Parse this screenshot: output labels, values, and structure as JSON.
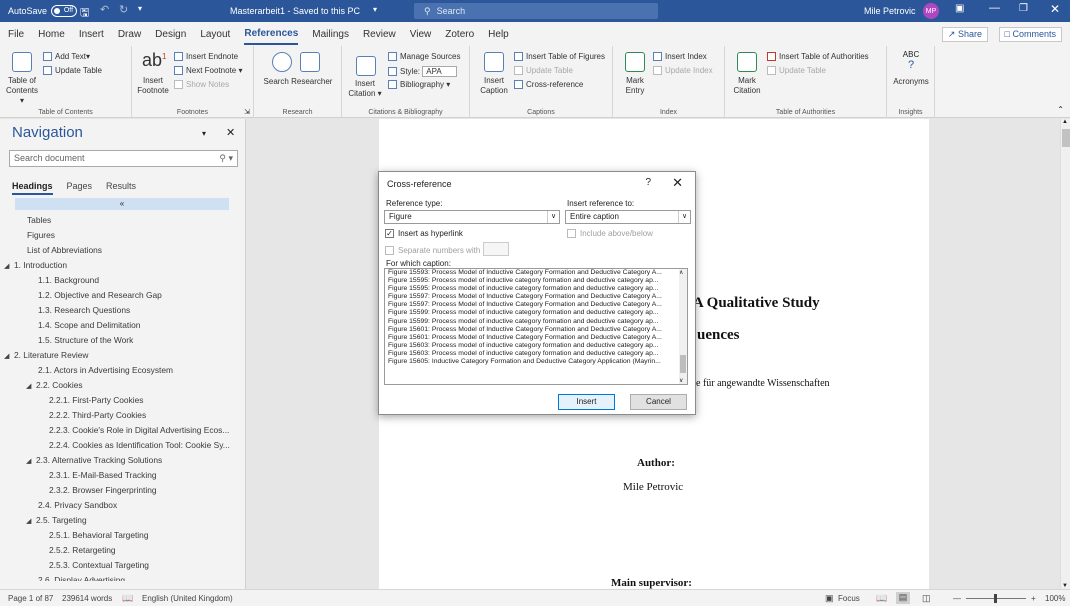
{
  "titlebar": {
    "autosave_label": "AutoSave",
    "autosave_state": "Off",
    "doc_title": "Masterarbeit1 - Saved to this PC",
    "search_placeholder": "Search",
    "user_name": "Mile Petrovic",
    "user_initials": "MP",
    "colors": {
      "bar": "#2b579a"
    }
  },
  "menus": [
    "File",
    "Home",
    "Insert",
    "Draw",
    "Design",
    "Layout",
    "References",
    "Mailings",
    "Review",
    "View",
    "Zotero",
    "Help"
  ],
  "active_menu": "References",
  "share_label": "Share",
  "comments_label": "Comments",
  "ribbon": {
    "toc": {
      "line1": "Table of",
      "line2": "Contents",
      "add_text": "Add Text",
      "update_table": "Update Table",
      "group": "Table of Contents"
    },
    "footnotes": {
      "insert1": "Insert",
      "insert2": "Footnote",
      "insert_endnote": "Insert Endnote",
      "next_footnote": "Next Footnote",
      "show_notes": "Show Notes",
      "group": "Footnotes"
    },
    "research": {
      "search_researcher": "Search Researcher",
      "group": "Research"
    },
    "citations": {
      "insert1": "Insert",
      "insert2": "Citation",
      "manage_sources": "Manage Sources",
      "style_label": "Style:",
      "style_value": "APA",
      "bibliography": "Bibliography",
      "group": "Citations & Bibliography"
    },
    "captions": {
      "insert1": "Insert",
      "insert2": "Caption",
      "insert_tof": "Insert Table of Figures",
      "update_table": "Update Table",
      "cross_reference": "Cross-reference",
      "group": "Captions"
    },
    "index": {
      "mark1": "Mark",
      "mark2": "Entry",
      "insert_index": "Insert Index",
      "update_index": "Update Index",
      "group": "Index"
    },
    "toa": {
      "mark1": "Mark",
      "mark2": "Citation",
      "insert_toa": "Insert Table of Authorities",
      "update_table": "Update Table",
      "group": "Table of Authorities"
    },
    "insights": {
      "abc": "ABC",
      "q": "?",
      "acronyms": "Acronyms",
      "group": "Insights"
    }
  },
  "navigation": {
    "title": "Navigation",
    "search_placeholder": "Search document",
    "tabs": [
      "Headings",
      "Pages",
      "Results"
    ],
    "selected_marker": "«",
    "items": [
      {
        "text": "Tables",
        "level": 1,
        "arrow": ""
      },
      {
        "text": "Figures",
        "level": 1,
        "arrow": ""
      },
      {
        "text": "List of Abbreviations",
        "level": 1,
        "arrow": ""
      },
      {
        "text": "1. Introduction",
        "level": 0,
        "arrow": "◢"
      },
      {
        "text": "1.1. Background",
        "level": 2,
        "arrow": ""
      },
      {
        "text": "1.2. Objective and Research Gap",
        "level": 2,
        "arrow": ""
      },
      {
        "text": "1.3. Research Questions",
        "level": 2,
        "arrow": ""
      },
      {
        "text": "1.4. Scope and Delimitation",
        "level": 2,
        "arrow": ""
      },
      {
        "text": "1.5. Structure of the Work",
        "level": 2,
        "arrow": ""
      },
      {
        "text": "2. Literature Review",
        "level": 0,
        "arrow": "◢"
      },
      {
        "text": "2.1. Actors in Advertising Ecosystem",
        "level": 2,
        "arrow": ""
      },
      {
        "text": "2.2. Cookies",
        "level": 1.5,
        "arrow": "◢"
      },
      {
        "text": "2.2.1. First-Party Cookies",
        "level": 3,
        "arrow": ""
      },
      {
        "text": "2.2.2. Third-Party Cookies",
        "level": 3,
        "arrow": ""
      },
      {
        "text": "2.2.3. Cookie's Role in Digital Advertising Ecos...",
        "level": 3,
        "arrow": ""
      },
      {
        "text": "2.2.4. Cookies as Identification Tool: Cookie Sy...",
        "level": 3,
        "arrow": ""
      },
      {
        "text": "2.3. Alternative Tracking Solutions",
        "level": 1.5,
        "arrow": "◢"
      },
      {
        "text": "2.3.1. E-Mail-Based Tracking",
        "level": 3,
        "arrow": ""
      },
      {
        "text": "2.3.2. Browser Fingerprinting",
        "level": 3,
        "arrow": ""
      },
      {
        "text": "2.4. Privacy Sandbox",
        "level": 2,
        "arrow": ""
      },
      {
        "text": "2.5. Targeting",
        "level": 1.5,
        "arrow": "◢"
      },
      {
        "text": "2.5.1. Behavioral Targeting",
        "level": 3,
        "arrow": ""
      },
      {
        "text": "2.5.2. Retargeting",
        "level": 3,
        "arrow": ""
      },
      {
        "text": "2.5.3. Contextual Targeting",
        "level": 3,
        "arrow": ""
      },
      {
        "text": "2.6. Display Advertising",
        "level": 2,
        "arrow": ""
      }
    ]
  },
  "document": {
    "title_fragment": ": A Qualitative Study",
    "title_fragment2": "uences",
    "university_fragment": "e für angewandte Wissenschaften",
    "author_label": "Author:",
    "author_name": "Mile Petrovic",
    "supervisor_label": "Main supervisor:"
  },
  "dialog": {
    "title": "Cross-reference",
    "help": "?",
    "close": "✕",
    "ref_type_label": "Reference type:",
    "ref_type_value": "Figure",
    "insert_ref_label": "Insert reference to:",
    "insert_ref_value": "Entire caption",
    "insert_hyperlink": "Insert as hyperlink",
    "include_above_below": "Include above/below",
    "separate_numbers": "Separate numbers with",
    "which_caption": "For which caption:",
    "captions": [
      "Figure 15593: Process Model of Inductive Category Formation and Deductive Category A...",
      "Figure 15595: Process model of inductive category formation and deductive category ap...",
      "Figure 15595: Process model of inductive category formation and deductive category ap...",
      "Figure 15597: Process Model of Inductive Category Formation and Deductive Category A...",
      "Figure 15597: Process Model of Inductive Category Formation and Deductive Category A...",
      "Figure 15599: Process model of inductive category formation and deductive category ap...",
      "Figure 15599: Process model of inductive category formation and deductive category ap...",
      "Figure 15601: Process Model of Inductive Category Formation and Deductive Category A...",
      "Figure 15601: Process Model of Inductive Category Formation and Deductive Category A...",
      "Figure 15603: Process model of inductive category formation and deductive category ap...",
      "Figure 15603: Process model of inductive category formation and deductive category ap...",
      "Figure 15605: Inductive Category Formation and Deductive Category Application (Mayrin..."
    ],
    "insert_button": "Insert",
    "cancel_button": "Cancel"
  },
  "status": {
    "page": "Page 1 of 87",
    "words": "239614 words",
    "language": "English (United Kingdom)",
    "focus": "Focus",
    "zoom": "100%"
  }
}
